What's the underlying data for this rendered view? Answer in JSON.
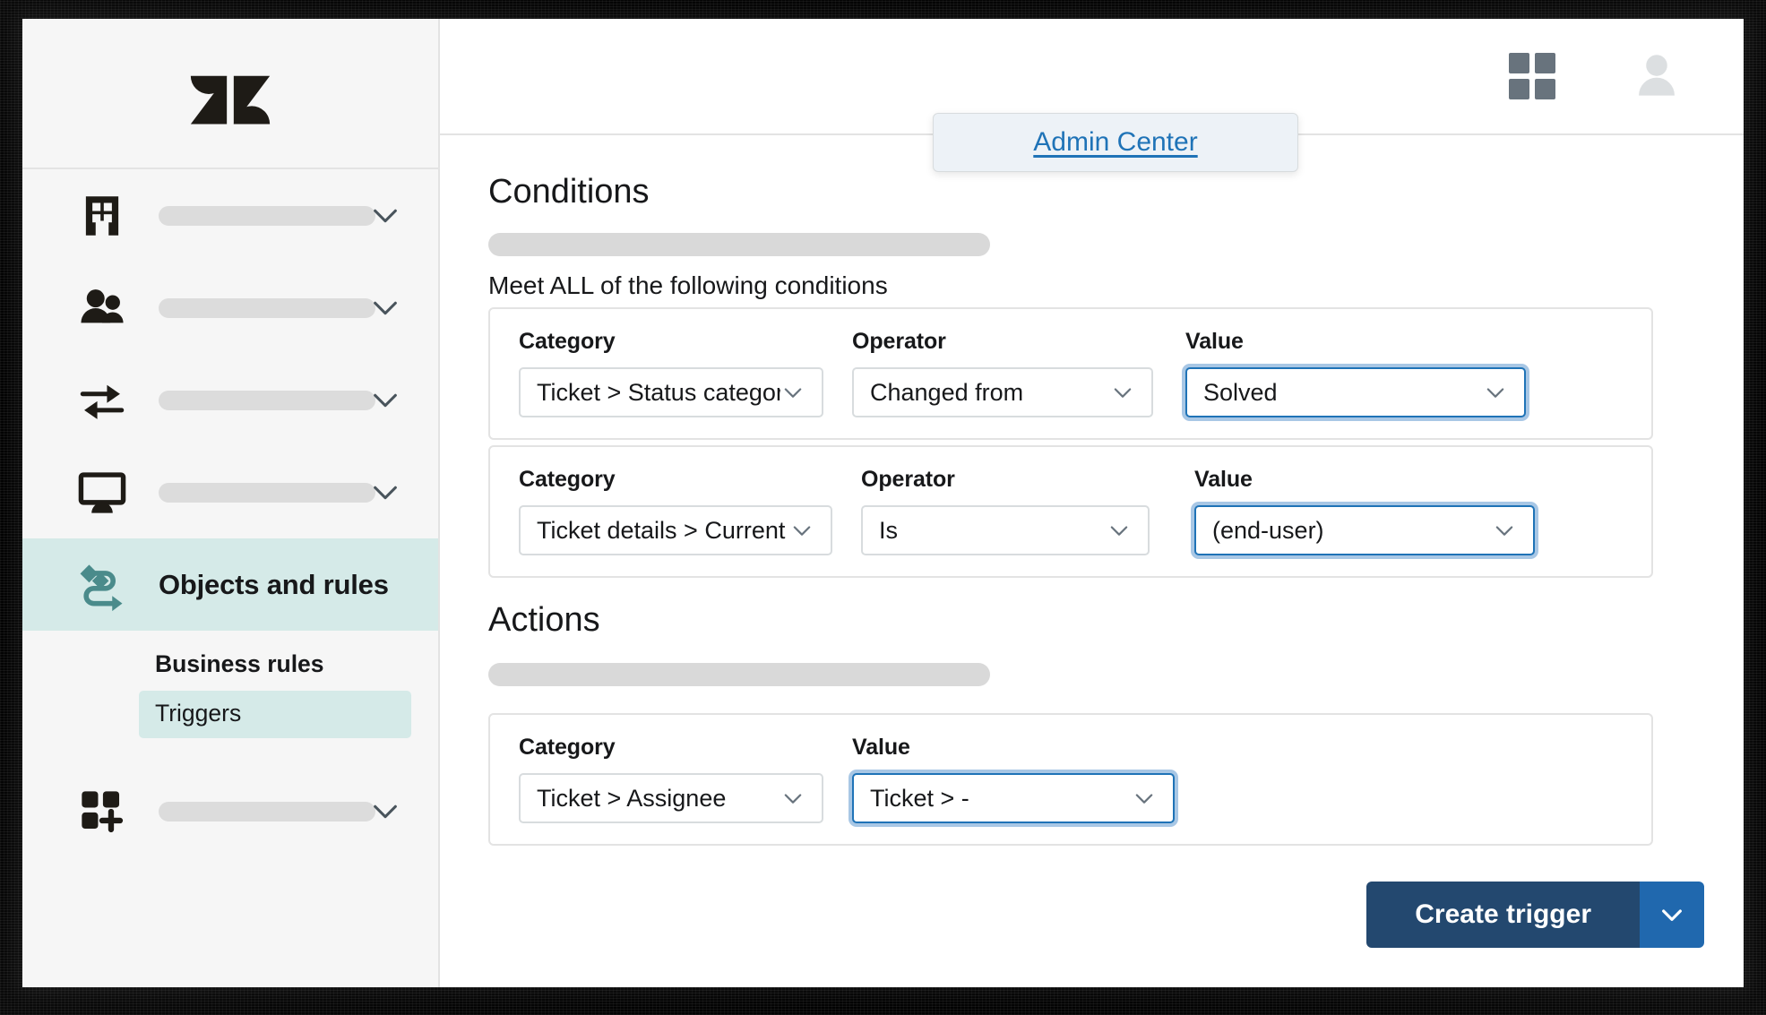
{
  "app": {
    "brand_logo": "zendesk-logo",
    "accent_teal": "#d5eae8",
    "link_blue": "#1f73b7",
    "primary_button": "#23486f",
    "caret_button": "#2068ae"
  },
  "header": {
    "apps_grid_icon": "grid-icon",
    "avatar_icon": "user-avatar-icon",
    "popover": {
      "link_label": "Admin Center"
    }
  },
  "sidebar": {
    "items": [
      {
        "icon": "building-icon",
        "label": "",
        "has_chevron": true,
        "active": false
      },
      {
        "icon": "people-icon",
        "label": "",
        "has_chevron": true,
        "active": false
      },
      {
        "icon": "two-way-arrows-icon",
        "label": "",
        "has_chevron": true,
        "active": false
      },
      {
        "icon": "monitor-icon",
        "label": "",
        "has_chevron": true,
        "active": false
      },
      {
        "icon": "objects-rules-icon",
        "label": "Objects and rules",
        "has_chevron": false,
        "active": true
      },
      {
        "icon": "apps-add-icon",
        "label": "",
        "has_chevron": true,
        "active": false
      }
    ],
    "sub_section_heading": "Business rules",
    "sub_section_selected": "Triggers"
  },
  "main": {
    "conditions": {
      "title": "Conditions",
      "helper": "Meet ALL of the following conditions",
      "rows": [
        {
          "category_label": "Category",
          "category_value": "Ticket > Status category",
          "operator_label": "Operator",
          "operator_value": "Changed from",
          "value_label": "Value",
          "value_value": "Solved",
          "value_focused": true
        },
        {
          "category_label": "Category",
          "category_value": "Ticket details > Current user",
          "operator_label": "Operator",
          "operator_value": "Is",
          "value_label": "Value",
          "value_value": "(end-user)",
          "value_focused": true
        }
      ]
    },
    "actions": {
      "title": "Actions",
      "rows": [
        {
          "category_label": "Category",
          "category_value": "Ticket > Assignee",
          "value_label": "Value",
          "value_value": "Ticket > -",
          "value_focused": true
        }
      ]
    },
    "footer": {
      "create_label": "Create trigger",
      "caret_icon": "chevron-down-icon"
    }
  }
}
